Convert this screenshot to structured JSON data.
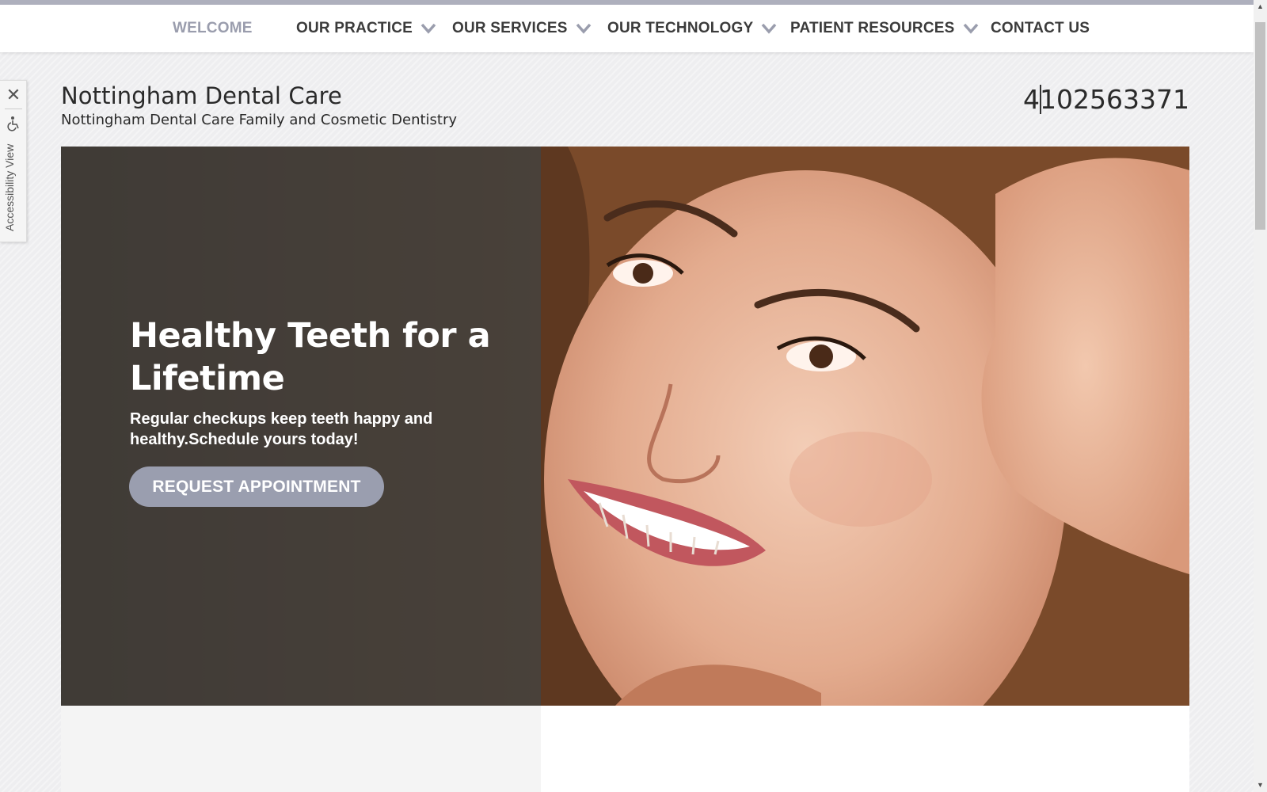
{
  "nav": {
    "items": [
      {
        "label": "WELCOME",
        "active": true,
        "dropdown": false
      },
      {
        "label": "OUR PRACTICE",
        "active": false,
        "dropdown": true
      },
      {
        "label": "OUR SERVICES",
        "active": false,
        "dropdown": true
      },
      {
        "label": "OUR TECHNOLOGY",
        "active": false,
        "dropdown": true
      },
      {
        "label": "PATIENT RESOURCES",
        "active": false,
        "dropdown": true
      },
      {
        "label": "CONTACT US",
        "active": false,
        "dropdown": false
      }
    ]
  },
  "header": {
    "title": "Nottingham Dental Care",
    "subtitle": "Nottingham Dental Care Family and Cosmetic Dentistry",
    "phone": "4102563371"
  },
  "accessibility": {
    "label": "Accessibility View"
  },
  "hero": {
    "heading": "Healthy Teeth for a Lifetime",
    "text": "Regular checkups keep teeth happy and healthy.Schedule yours today!",
    "button_label": "REQUEST APPOINTMENT"
  },
  "colors": {
    "accent": "#9a9eaf",
    "nav_active": "#9a9dad",
    "topbar_border": "#aeb0bd"
  }
}
